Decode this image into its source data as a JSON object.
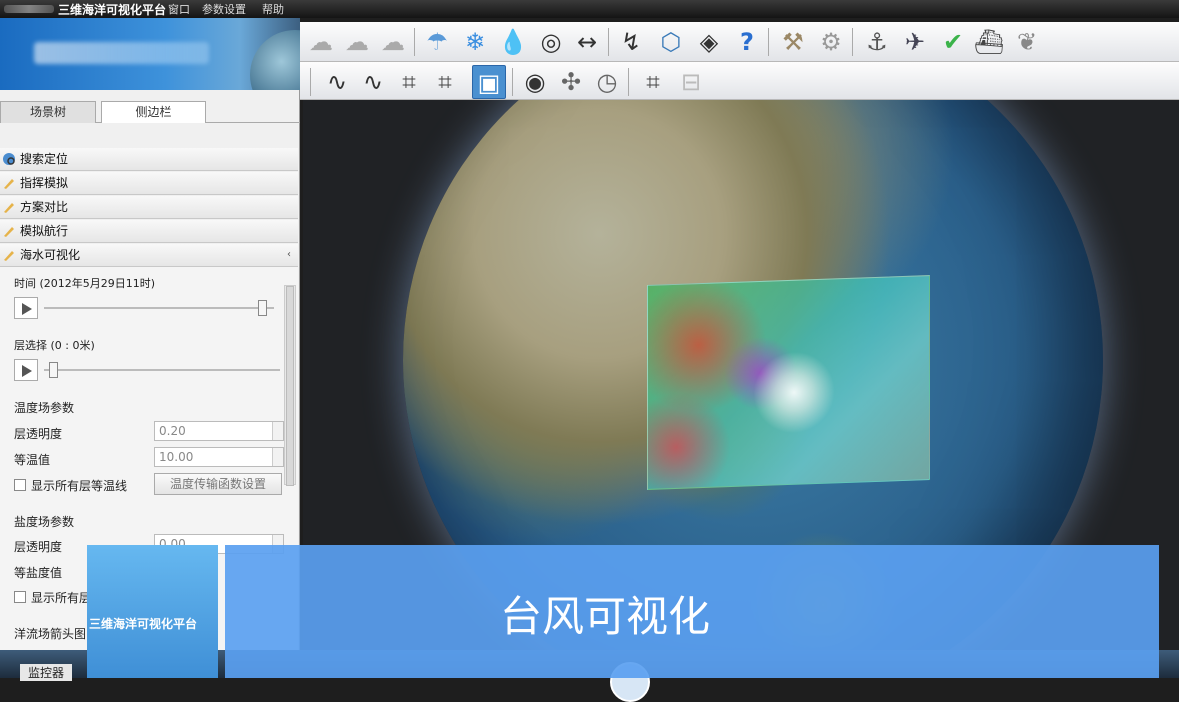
{
  "titlebar": {
    "title": "三维海洋可视化平台",
    "menus": [
      "窗口",
      "参数设置",
      "帮助"
    ]
  },
  "left": {
    "tabs": [
      "场景树",
      "侧边栏"
    ],
    "sections": [
      {
        "label": "搜索定位"
      },
      {
        "label": "指挥模拟"
      },
      {
        "label": "方案对比"
      },
      {
        "label": "模拟航行"
      },
      {
        "label": "海水可视化"
      }
    ],
    "time_label": "时间 (2012年5月29日11时)",
    "time_slider_fraction": 0.93,
    "layer_label": "层选择 (0 : 0米)",
    "layer_slider_fraction": 0.02,
    "temp_group": "温度场参数",
    "temp_alpha_label": "层透明度",
    "temp_alpha_value": "0.20",
    "temp_iso_label": "等温值",
    "temp_iso_value": "10.00",
    "temp_show_label": "显示所有层等温线",
    "temp_btn": "温度传输函数设置",
    "salt_group": "盐度场参数",
    "salt_alpha_label": "层透明度",
    "salt_alpha_value": "0.00",
    "salt_iso_label": "等盐度值",
    "salt_show_label": "显示所有层",
    "current_group": "洋流场箭头图",
    "monitor_label": "监控器"
  },
  "overlay": {
    "logo_text": "三维海洋可视化平台",
    "caption": "台风可视化"
  },
  "toolbar1": [
    "cloud-icon",
    "cloud-icon",
    "cloud-icon",
    "rain-icon",
    "snow-icon",
    "water-drop-icon",
    "radar-icon",
    "measure-icon",
    "ship-route-icon",
    "box-map-icon",
    "layers-icon",
    "help-icon",
    "tool-icon",
    "tool-icon",
    "robot-arm-icon",
    "plane-icon",
    "check-icon",
    "ship-icon",
    "leaf-icon"
  ],
  "toolbar2": [
    "wave-icon",
    "wave-stop-icon",
    "crop-icon",
    "crop-stop-icon",
    "screen-icon",
    "location-icon",
    "network-icon",
    "clock-icon",
    "crop-export-icon",
    "export-icon"
  ],
  "colors": {
    "accent": "#5aa0f0",
    "banner": "#1a6bc0"
  }
}
